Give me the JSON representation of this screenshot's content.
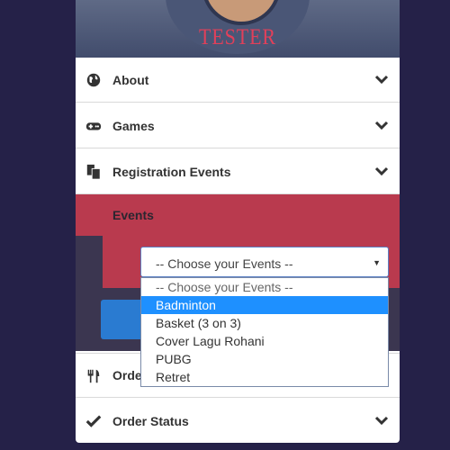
{
  "profile": {
    "name": "TESTER"
  },
  "menu": {
    "about": "About",
    "games": "Games",
    "registration": "Registration Events",
    "events": "Events",
    "order": "Orde",
    "order_status": "Order Status"
  },
  "events_select": {
    "value": "-- Choose your Events --",
    "options": [
      "-- Choose your Events --",
      "Badminton",
      "Basket (3 on 3)",
      "Cover Lagu Rohani",
      "PUBG",
      "Retret"
    ],
    "highlighted": "Badminton"
  }
}
